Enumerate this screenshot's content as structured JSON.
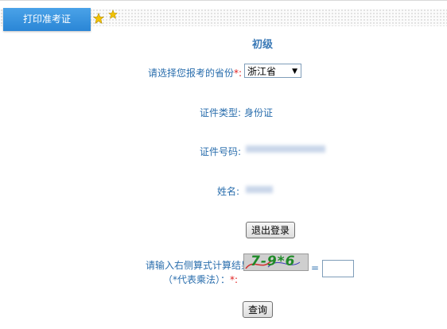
{
  "header": {
    "tab_label": "打印准考证",
    "star_color": "#f2c200"
  },
  "form": {
    "level_title": "初级",
    "province": {
      "label": "请选择您报考的省份",
      "required_mark": "*:",
      "selected": "浙江省"
    },
    "id_type": {
      "label": "证件类型:",
      "value": "身份证"
    },
    "id_number": {
      "label": "证件号码:"
    },
    "name": {
      "label": "姓名:"
    },
    "logout_button": "退出登录",
    "captcha": {
      "label_line1": "请输入右侧算式计算结果",
      "label_line2": "（*代表乘法）：",
      "required_mark": "*:",
      "expression": "7-9*6",
      "equals": "="
    },
    "query_button": "查询"
  },
  "colors": {
    "accent": "#2a86d6",
    "label_text": "#2a6ead",
    "required": "#e02020",
    "captcha_text": "#1f8a28"
  }
}
